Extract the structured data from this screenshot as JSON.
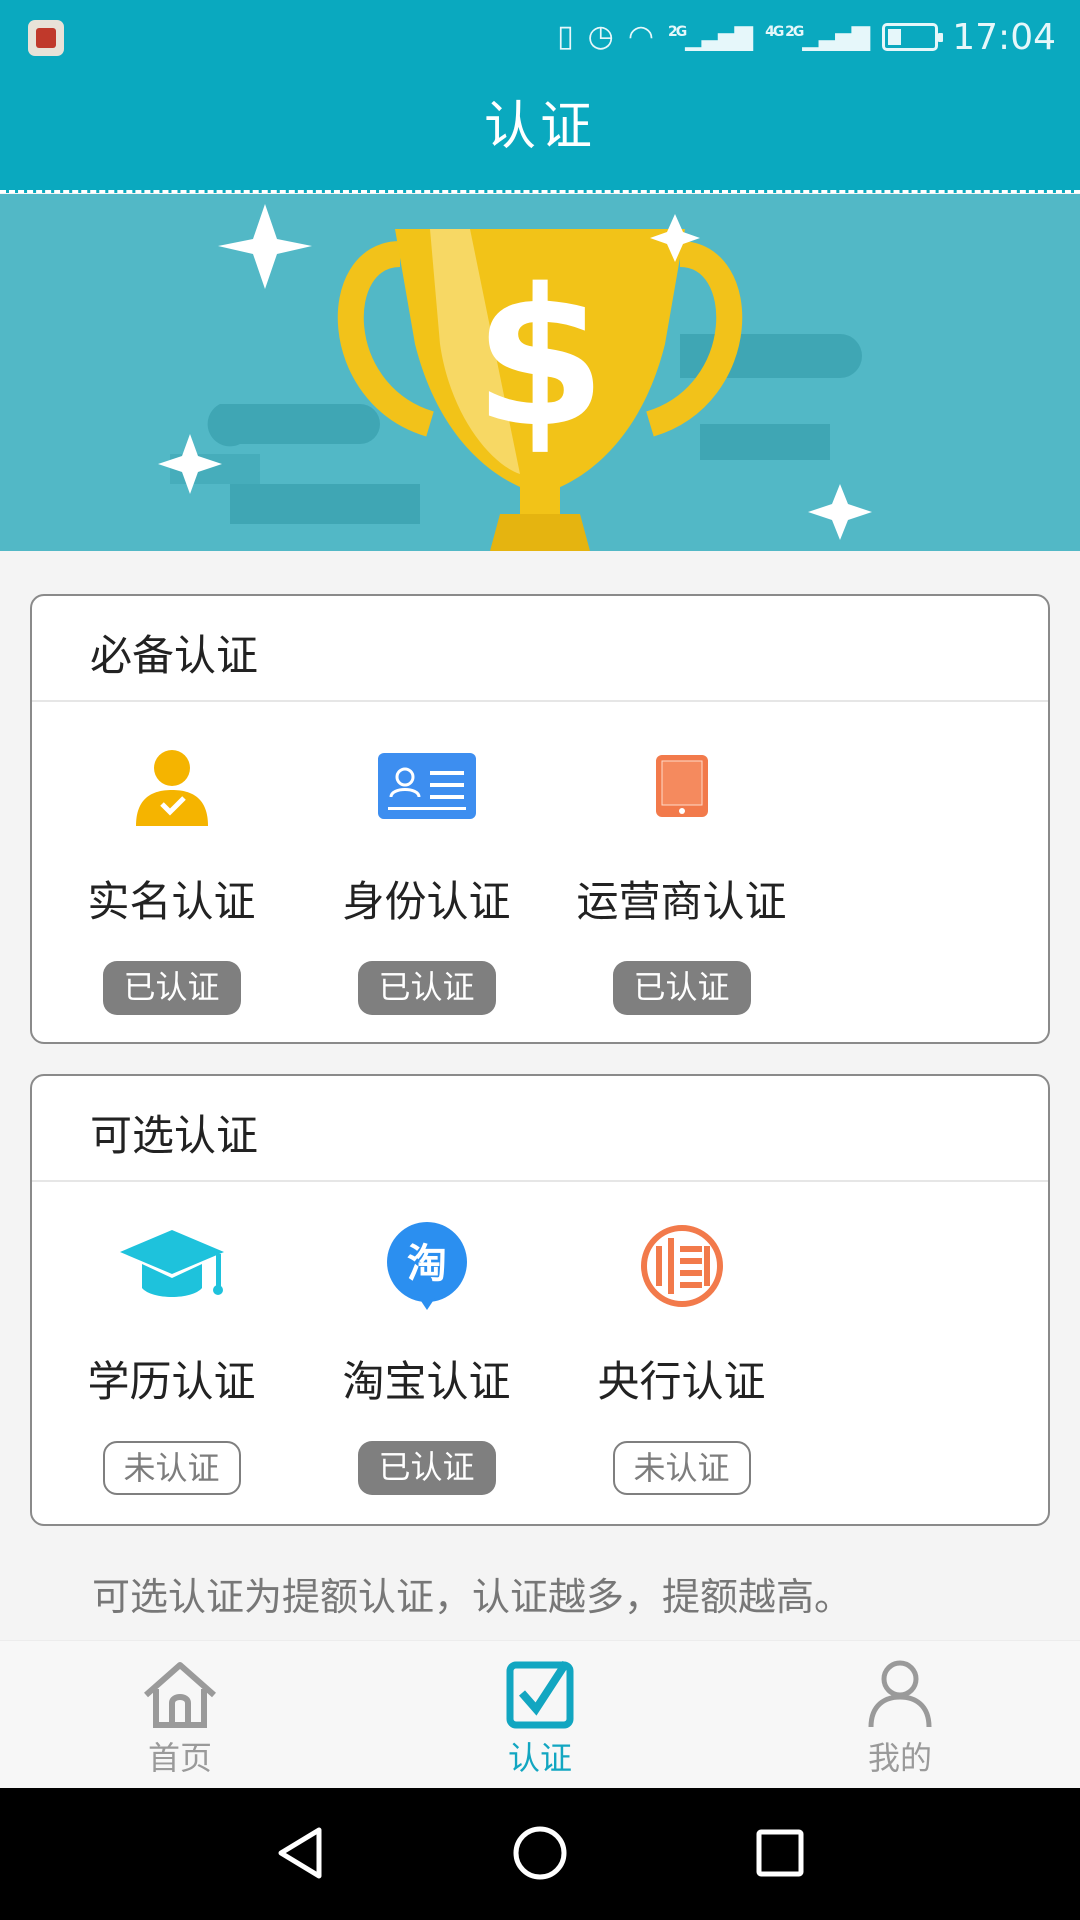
{
  "status_bar": {
    "time": "17:04",
    "signal_1": "2G",
    "signal_2": "4G 2G"
  },
  "header": {
    "title": "认证"
  },
  "required_section": {
    "title": "必备认证",
    "items": [
      {
        "label": "实名认证",
        "status": "已认证",
        "icon": "person-check-icon",
        "color": "#f5b400"
      },
      {
        "label": "身份认证",
        "status": "已认证",
        "icon": "id-card-icon",
        "color": "#3d8ef0"
      },
      {
        "label": "运营商认证",
        "status": "已认证",
        "icon": "phone-icon",
        "color": "#f27a4b"
      }
    ]
  },
  "optional_section": {
    "title": "可选认证",
    "items": [
      {
        "label": "学历认证",
        "status": "未认证",
        "icon": "graduation-cap-icon",
        "color": "#1ec2dc"
      },
      {
        "label": "淘宝认证",
        "status": "已认证",
        "icon": "taobao-icon",
        "icon_text": "淘",
        "color": "#2b8ff0"
      },
      {
        "label": "央行认证",
        "status": "未认证",
        "icon": "central-bank-seal-icon",
        "color": "#f27a4b"
      }
    ]
  },
  "note": "可选认证为提额认证，认证越多，提额越高。",
  "tabbar": {
    "items": [
      {
        "label": "首页",
        "icon": "home-icon"
      },
      {
        "label": "认证",
        "icon": "checkbox-icon",
        "active": true
      },
      {
        "label": "我的",
        "icon": "user-icon"
      }
    ]
  },
  "colors": {
    "header": "#0aa9bf",
    "banner": "#52b8c6",
    "active_tab": "#12a6c1",
    "done_badge": "#7f7f7f"
  }
}
